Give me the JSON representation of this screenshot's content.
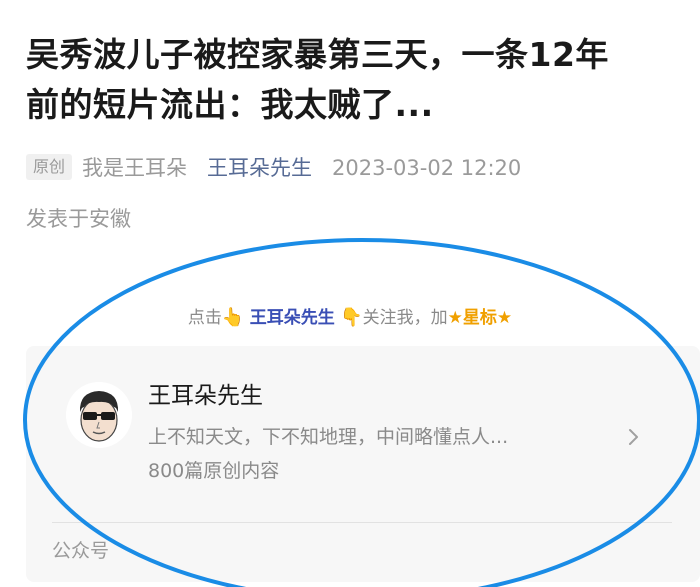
{
  "article": {
    "title_line1": "吴秀波儿子被控家暴第三天，一条12年",
    "title_line2": "前的短片流出：我太贼了...",
    "tag": "原创",
    "author": "我是王耳朵",
    "account_name": "王耳朵先生",
    "datetime": "2023-03-02 12:20",
    "location": "发表于安徽"
  },
  "follow_prompt": {
    "prefix": "点击",
    "pointing_up": "👆",
    "name": "王耳朵先生",
    "pointing_down": "👇",
    "middle": "关注我，加",
    "star_label": "★星标★"
  },
  "account_card": {
    "name": "王耳朵先生",
    "description": "上不知天文，下不知地理，中间略懂点人...",
    "count": "800篇原创内容",
    "type": "公众号",
    "avatar_icon": "cartoon-avatar-with-sunglasses",
    "chevron_icon": "chevron-right-icon"
  },
  "annotation": {
    "shape": "ellipse",
    "color": "#1a8ce6"
  }
}
